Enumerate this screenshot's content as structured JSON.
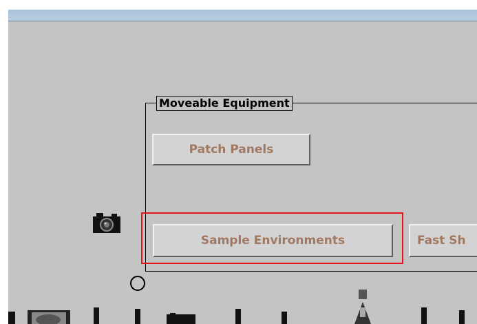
{
  "group": {
    "title": "Moveable Equipment"
  },
  "buttons": {
    "patch_panels": "Patch Panels",
    "sample_environments": "Sample Environments",
    "fast": "Fast Sh"
  },
  "icons": {
    "camera": "camera-icon",
    "circle": "circle-icon"
  },
  "colors": {
    "background": "#c4c4c4",
    "button_text": "#a07862",
    "highlight": "#e3141a"
  }
}
